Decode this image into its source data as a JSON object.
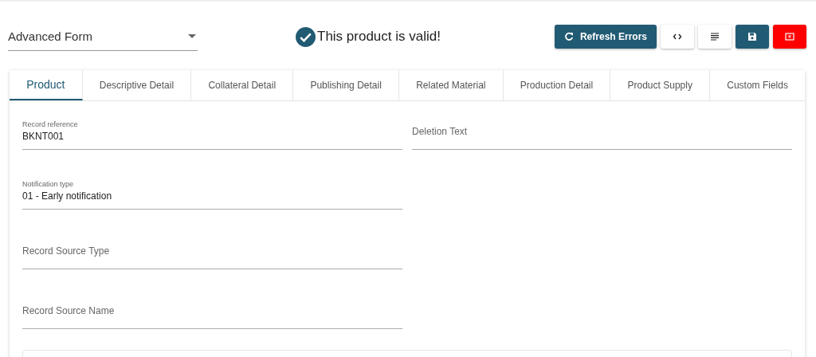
{
  "form_selector": {
    "value": "Advanced Form"
  },
  "validation": {
    "message": "This product is valid!"
  },
  "toolbar": [
    {
      "kind": "refresh",
      "label": "Refresh Errors"
    },
    {
      "kind": "code"
    },
    {
      "kind": "text"
    },
    {
      "kind": "save"
    },
    {
      "kind": "close"
    }
  ],
  "tabs": [
    {
      "label": "Product",
      "selected": true
    },
    {
      "label": "Descriptive Detail",
      "selected": false
    },
    {
      "label": "Collateral Detail",
      "selected": false
    },
    {
      "label": "Publishing Detail",
      "selected": false
    },
    {
      "label": "Related Material",
      "selected": false
    },
    {
      "label": "Production Detail",
      "selected": false
    },
    {
      "label": "Product Supply",
      "selected": false
    },
    {
      "label": "Custom Fields",
      "selected": false
    }
  ],
  "left_fields": [
    {
      "label": "Record reference",
      "value": "BKNT001"
    },
    {
      "label": "Notification type",
      "value": "01 - Early notification"
    },
    {
      "placeholder": "Record Source Type"
    },
    {
      "placeholder": "Record Source Name"
    }
  ],
  "right_fields": [
    {
      "placeholder": "Deletion Text"
    }
  ]
}
